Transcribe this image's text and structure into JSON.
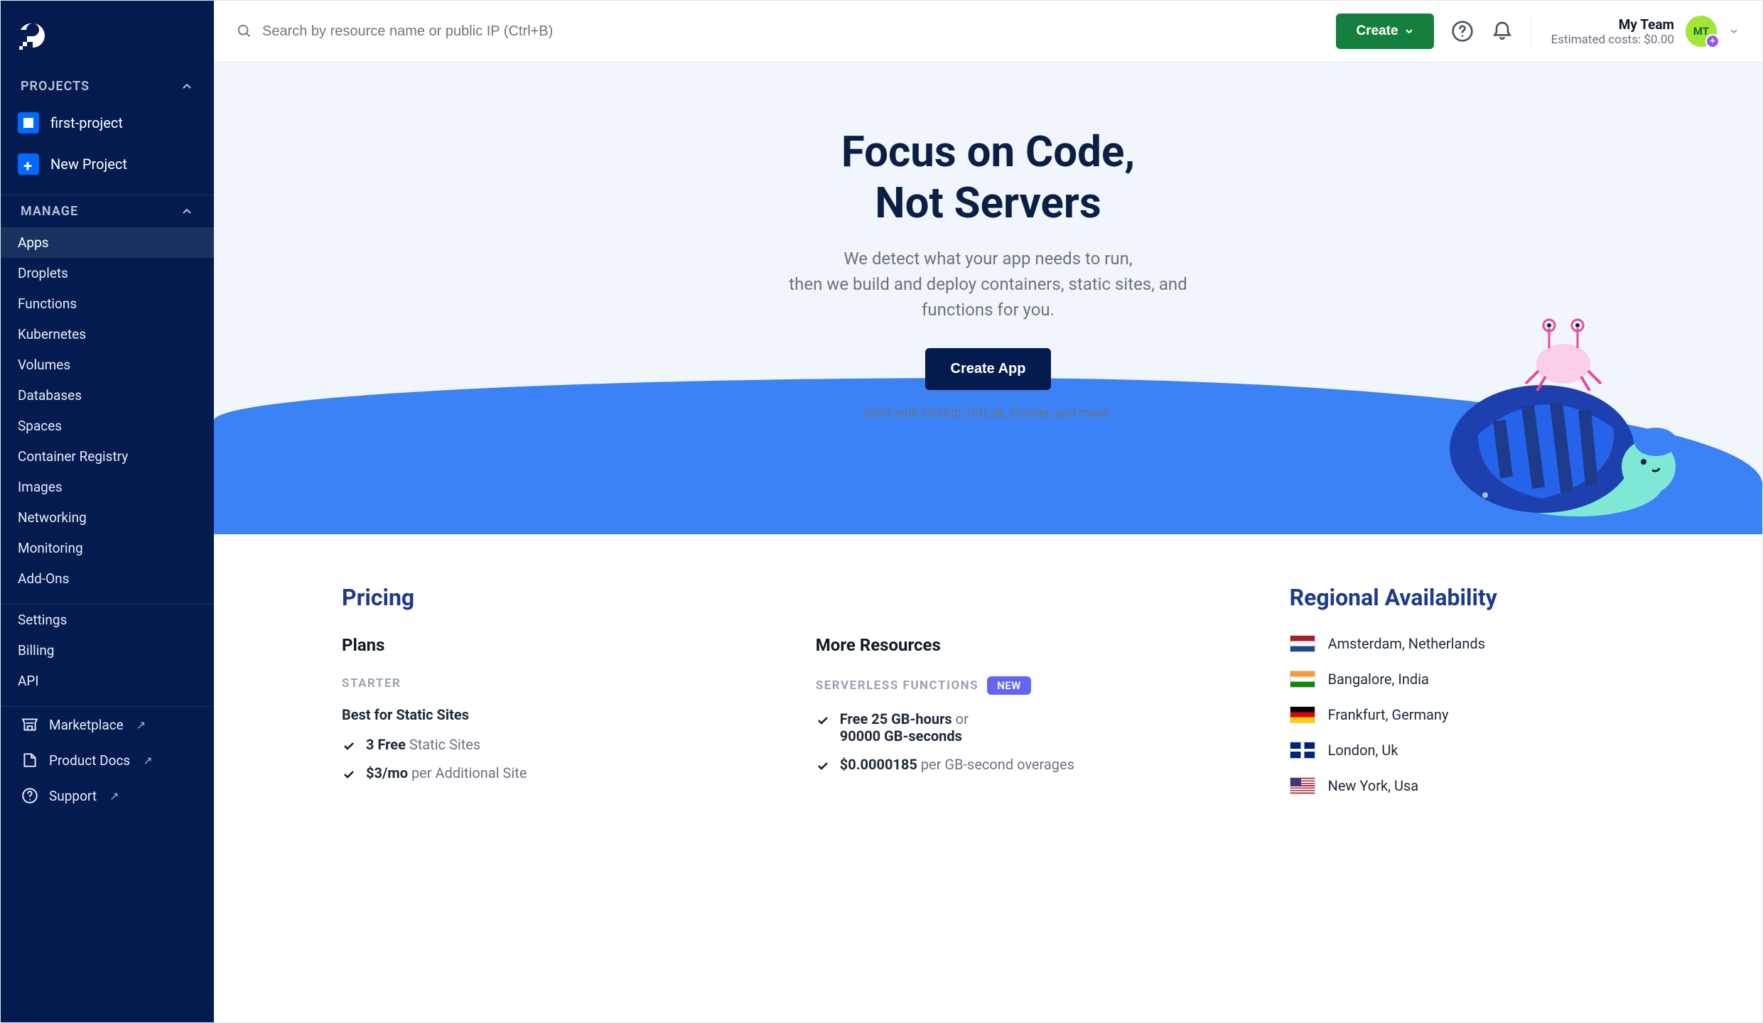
{
  "sidebar": {
    "sections": {
      "projects_label": "PROJECTS",
      "manage_label": "MANAGE"
    },
    "projects": [
      {
        "label": "first-project"
      }
    ],
    "new_project_label": "New Project",
    "manage_items": [
      "Apps",
      "Droplets",
      "Functions",
      "Kubernetes",
      "Volumes",
      "Databases",
      "Spaces",
      "Container Registry",
      "Images",
      "Networking",
      "Monitoring",
      "Add-Ons"
    ],
    "secondary": [
      "Settings",
      "Billing",
      "API"
    ],
    "lower": [
      {
        "label": "Marketplace"
      },
      {
        "label": "Product Docs"
      },
      {
        "label": "Support"
      }
    ]
  },
  "topbar": {
    "search_placeholder": "Search by resource name or public IP (Ctrl+B)",
    "create_label": "Create",
    "team_name": "My Team",
    "estimated_costs_label": "Estimated costs: $0.00",
    "avatar_initials": "MT"
  },
  "hero": {
    "title_line1": "Focus on Code,",
    "title_line2": "Not Servers",
    "subtitle_line1": "We detect what your app needs to run,",
    "subtitle_line2": "then we build and deploy containers, static sites, and",
    "subtitle_line3": "functions for you.",
    "cta_label": "Create App",
    "start_with": "Start with GitHub, GitLab, Docker, and more."
  },
  "pricing": {
    "heading": "Pricing",
    "plans_heading": "Plans",
    "starter_eyebrow": "STARTER",
    "starter_title": "Best for Static Sites",
    "starter_items": [
      {
        "bold": "3 Free",
        "rest": " Static Sites"
      },
      {
        "bold": "$3/mo",
        "rest": " per Additional Site"
      }
    ],
    "resources_heading": "More Resources",
    "serverless_eyebrow": "SERVERLESS FUNCTIONS",
    "new_badge": "NEW",
    "serverless_items": [
      {
        "bold": "Free 25 GB-hours",
        "rest": " or ",
        "bold2": "90000 GB-seconds"
      },
      {
        "bold": "$0.0000185",
        "rest": " per GB-second overages"
      }
    ]
  },
  "regions": {
    "heading": "Regional Availability",
    "list": [
      {
        "flag": "nl",
        "label": "Amsterdam, Netherlands"
      },
      {
        "flag": "in",
        "label": "Bangalore, India"
      },
      {
        "flag": "de",
        "label": "Frankfurt, Germany"
      },
      {
        "flag": "uk",
        "label": "London, Uk"
      },
      {
        "flag": "us",
        "label": "New York, Usa"
      }
    ]
  }
}
